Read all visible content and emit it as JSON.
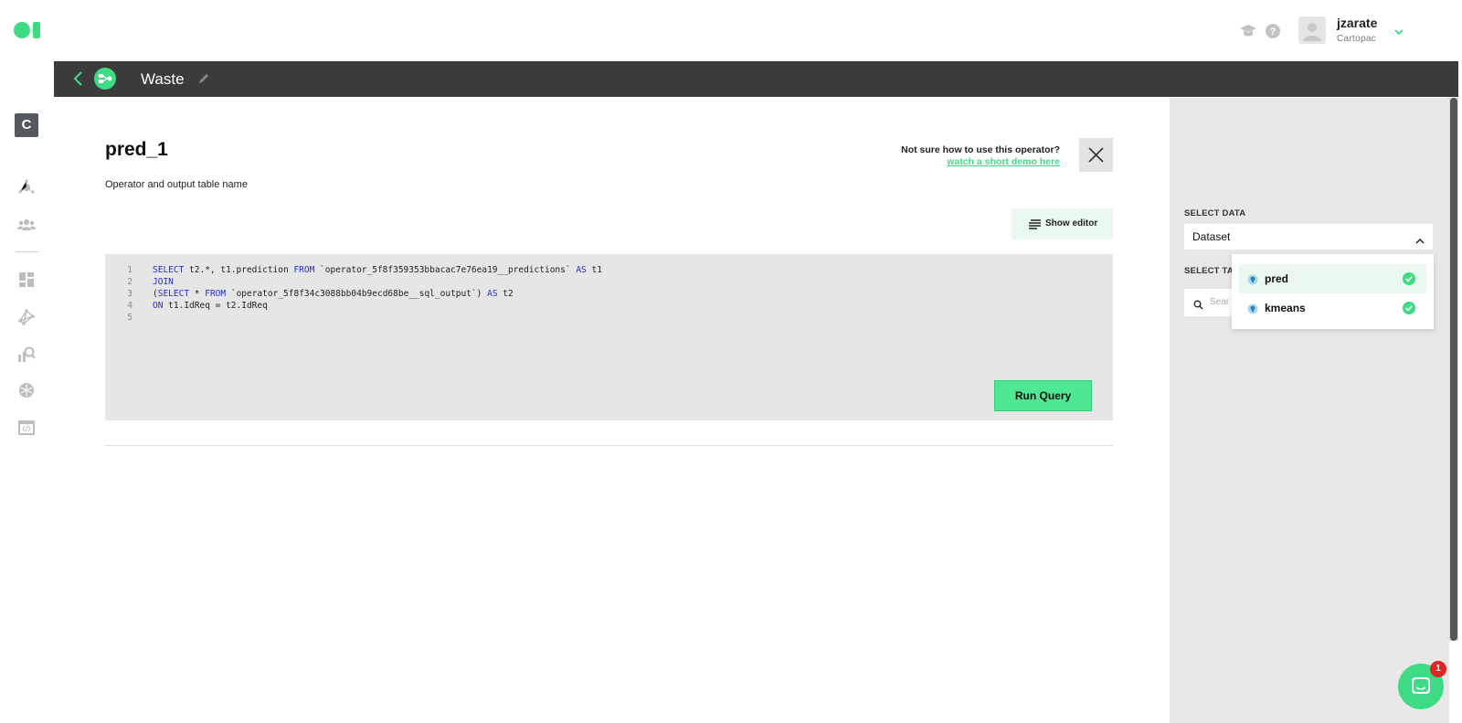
{
  "topbar": {
    "user_name": "jzarate",
    "user_org": "Cartopac",
    "icons": [
      "graduation-cap-icon",
      "help-icon",
      "avatar",
      "chevron-down-icon"
    ]
  },
  "sidebar": {
    "workspace_letter": "C",
    "items": [
      "nodes-icon",
      "users-icon",
      "dashboard-icon",
      "network-icon",
      "analytics-icon",
      "brain-icon",
      "code-icon"
    ]
  },
  "header": {
    "title": "Waste"
  },
  "operator": {
    "title": "pred_1",
    "subtitle": "Operator and output table name",
    "help_question": "Not sure how to use this operator?",
    "help_link": "watch a short demo here",
    "show_editor_label": "Show editor",
    "run_query_label": "Run Query",
    "code_lines": [
      {
        "num": "1",
        "parts": [
          {
            "t": "SELECT",
            "kw": true
          },
          {
            "t": " t2.*, t1.prediction "
          },
          {
            "t": "FROM",
            "kw": true
          },
          {
            "t": " `operator_5f8f359353bbacac7e76ea19__predictions` "
          },
          {
            "t": "AS",
            "kw": true
          },
          {
            "t": " t1"
          }
        ]
      },
      {
        "num": "2",
        "parts": [
          {
            "t": "JOIN",
            "kw": true
          }
        ]
      },
      {
        "num": "3",
        "parts": [
          {
            "t": "("
          },
          {
            "t": "SELECT",
            "kw": true
          },
          {
            "t": " * "
          },
          {
            "t": "FROM",
            "kw": true
          },
          {
            "t": " `operator_5f8f34c3088bb04b9ecd68be__sql_output`) "
          },
          {
            "t": "AS",
            "kw": true
          },
          {
            "t": " t2"
          }
        ]
      },
      {
        "num": "4",
        "parts": [
          {
            "t": "ON",
            "kw": true
          },
          {
            "t": " t1.IdReq = t2.IdReq"
          }
        ]
      },
      {
        "num": "5",
        "parts": []
      }
    ]
  },
  "right_panel": {
    "select_data_label": "SELECT DATA",
    "dataset_value": "Dataset",
    "select_table_label": "SELECT TA",
    "search_placeholder": "Sear",
    "dropdown_items": [
      {
        "name": "pred",
        "selected": true
      },
      {
        "name": "kmeans",
        "selected": false
      }
    ]
  },
  "chat": {
    "badge_count": "1"
  },
  "colors": {
    "accent": "#3ddc84",
    "header_bg": "#3b3b3b",
    "keyword": "#2030d0"
  }
}
